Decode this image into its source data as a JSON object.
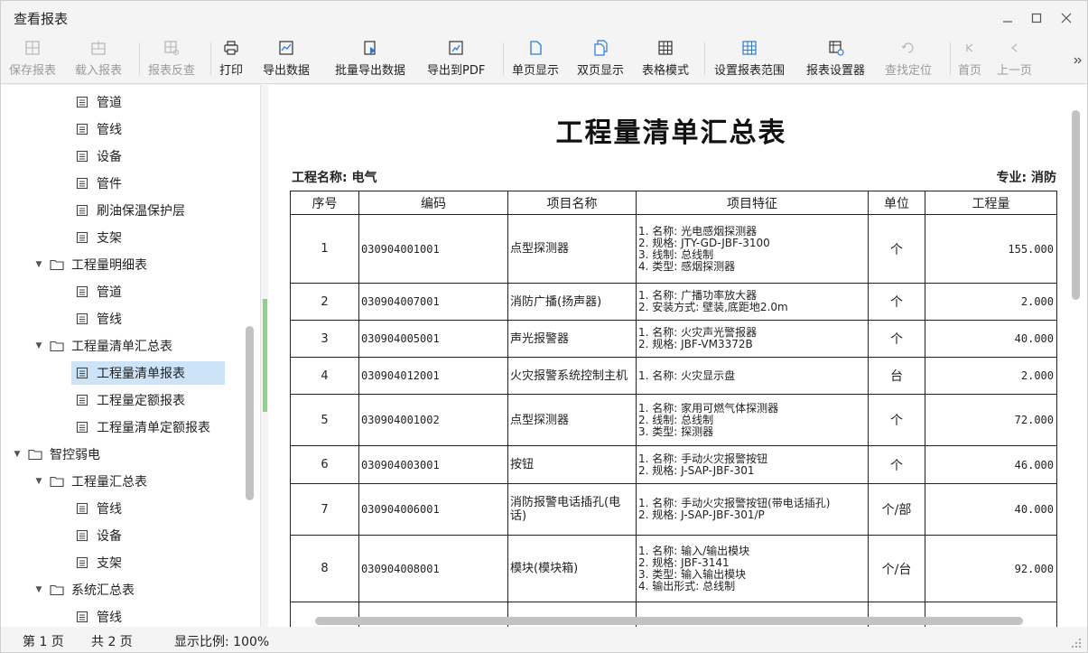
{
  "window": {
    "title": "查看报表"
  },
  "toolbar": {
    "save_report": "保存报表",
    "load_report": "载入报表",
    "report_check": "报表反查",
    "print": "打印",
    "export_data": "导出数据",
    "batch_export": "批量导出数据",
    "export_pdf": "导出到PDF",
    "single_page": "单页显示",
    "double_page": "双页显示",
    "table_mode": "表格模式",
    "set_range": "设置报表范围",
    "report_settings": "报表设置器",
    "find_locate": "查找定位",
    "first_page": "首页",
    "prev_page": "上一页"
  },
  "tree": {
    "items": [
      {
        "label": "管道"
      },
      {
        "label": "管线"
      },
      {
        "label": "设备"
      },
      {
        "label": "管件"
      },
      {
        "label": "刷油保温保护层"
      },
      {
        "label": "支架"
      },
      {
        "label": "工程量明细表"
      },
      {
        "label": "管道"
      },
      {
        "label": "管线"
      },
      {
        "label": "工程量清单汇总表"
      },
      {
        "label": "工程量清单报表"
      },
      {
        "label": "工程量定额报表"
      },
      {
        "label": "工程量清单定额报表"
      },
      {
        "label": "智控弱电"
      },
      {
        "label": "工程量汇总表"
      },
      {
        "label": "管线"
      },
      {
        "label": "设备"
      },
      {
        "label": "支架"
      },
      {
        "label": "系统汇总表"
      },
      {
        "label": "管线"
      }
    ]
  },
  "report": {
    "title": "工程量清单汇总表",
    "project_name": "工程名称: 电气",
    "specialty": "专业: 消防",
    "columns": [
      "序号",
      "编码",
      "项目名称",
      "项目特征",
      "单位",
      "工程量"
    ],
    "rows": [
      {
        "no": "1",
        "code": "030904001001",
        "name": "点型探测器",
        "features": [
          "1. 名称: 光电感烟探测器",
          "2. 规格: JTY-GD-JBF-3100",
          "3. 线制: 总线制",
          "4. 类型: 感烟探测器"
        ],
        "unit": "个",
        "qty": "155.000"
      },
      {
        "no": "2",
        "code": "030904007001",
        "name": "消防广播(扬声器)",
        "features": [
          "1. 名称: 广播功率放大器",
          "2. 安装方式: 壁装,底距地2.0m"
        ],
        "unit": "个",
        "qty": "2.000"
      },
      {
        "no": "3",
        "code": "030904005001",
        "name": "声光报警器",
        "features": [
          "1. 名称: 火灾声光警报器",
          "2. 规格: JBF-VM3372B"
        ],
        "unit": "个",
        "qty": "40.000"
      },
      {
        "no": "4",
        "code": "030904012001",
        "name": "火灾报警系统控制主机",
        "features": [
          "1. 名称: 火灾显示盘"
        ],
        "unit": "台",
        "qty": "2.000"
      },
      {
        "no": "5",
        "code": "030904001002",
        "name": "点型探测器",
        "features": [
          "1. 名称: 家用可燃气体探测器",
          "2. 线制: 总线制",
          "3. 类型: 探测器"
        ],
        "unit": "个",
        "qty": "72.000"
      },
      {
        "no": "6",
        "code": "030904003001",
        "name": "按钮",
        "features": [
          "1. 名称: 手动火灾报警按钮",
          "2. 规格: J-SAP-JBF-301"
        ],
        "unit": "个",
        "qty": "46.000"
      },
      {
        "no": "7",
        "code": "030904006001",
        "name": "消防报警电话插孔(电话)",
        "features": [
          "1. 名称: 手动火灾报警按钮(带电话插孔)",
          "2. 规格: J-SAP-JBF-301/P"
        ],
        "unit": "个/部",
        "qty": "40.000"
      },
      {
        "no": "8",
        "code": "030904008001",
        "name": "模块(模块箱)",
        "features": [
          "1. 名称: 输入/输出模块",
          "2. 规格: JBF-3141",
          "3. 类型: 输入输出模块",
          "4. 输出形式: 总线制"
        ],
        "unit": "个/台",
        "qty": "92.000"
      }
    ]
  },
  "status": {
    "page": "第 1 页",
    "total": "共 2 页",
    "zoom": "显示比例: 100%"
  }
}
